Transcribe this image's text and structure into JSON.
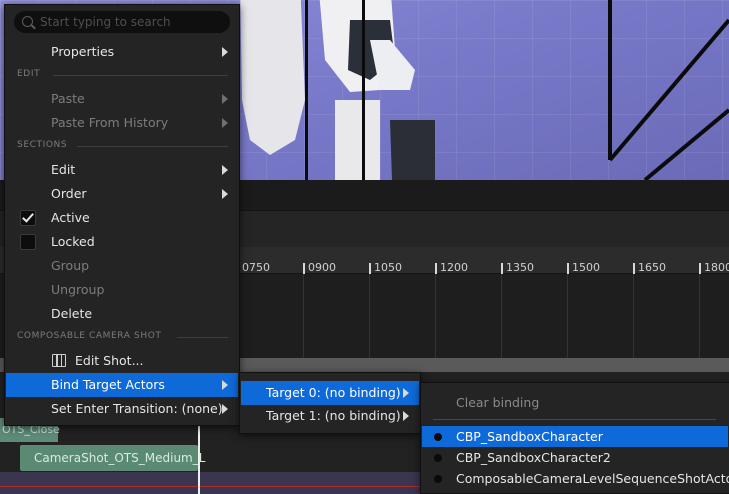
{
  "search": {
    "placeholder": "Start typing to search"
  },
  "sections": {
    "edit": "EDIT",
    "sections": "SECTIONS",
    "composable": "COMPOSABLE CAMERA SHOT"
  },
  "menu": {
    "properties": "Properties",
    "paste": "Paste",
    "paste_history": "Paste From History",
    "edit": "Edit",
    "order": "Order",
    "active": "Active",
    "locked": "Locked",
    "group": "Group",
    "ungroup": "Ungroup",
    "delete": "Delete",
    "edit_shot": "Edit Shot...",
    "bind_target_actors": "Bind Target Actors",
    "set_enter_transition": "Set Enter Transition: (none)"
  },
  "checks": {
    "active": true,
    "locked": false
  },
  "submenu_targets": {
    "target0": "Target 0: (no binding)",
    "target1": "Target 1: (no binding)"
  },
  "submenu_bindings": {
    "clear": "Clear binding",
    "actors": [
      "CBP_SandboxCharacter",
      "CBP_SandboxCharacter2",
      "ComposableCameraLevelSequenceShotActor"
    ]
  },
  "timeline": {
    "ticks": [
      "0750",
      "0900",
      "1050",
      "1200",
      "1350",
      "1500",
      "1650",
      "1800"
    ],
    "clip_teal": "CameraShot_OTS_Medium_L",
    "clip_left": "OTS_Close"
  },
  "colors": {
    "highlight": "#0f6ad9",
    "menu_bg": "#242424",
    "viewport": "#7a7acb"
  }
}
